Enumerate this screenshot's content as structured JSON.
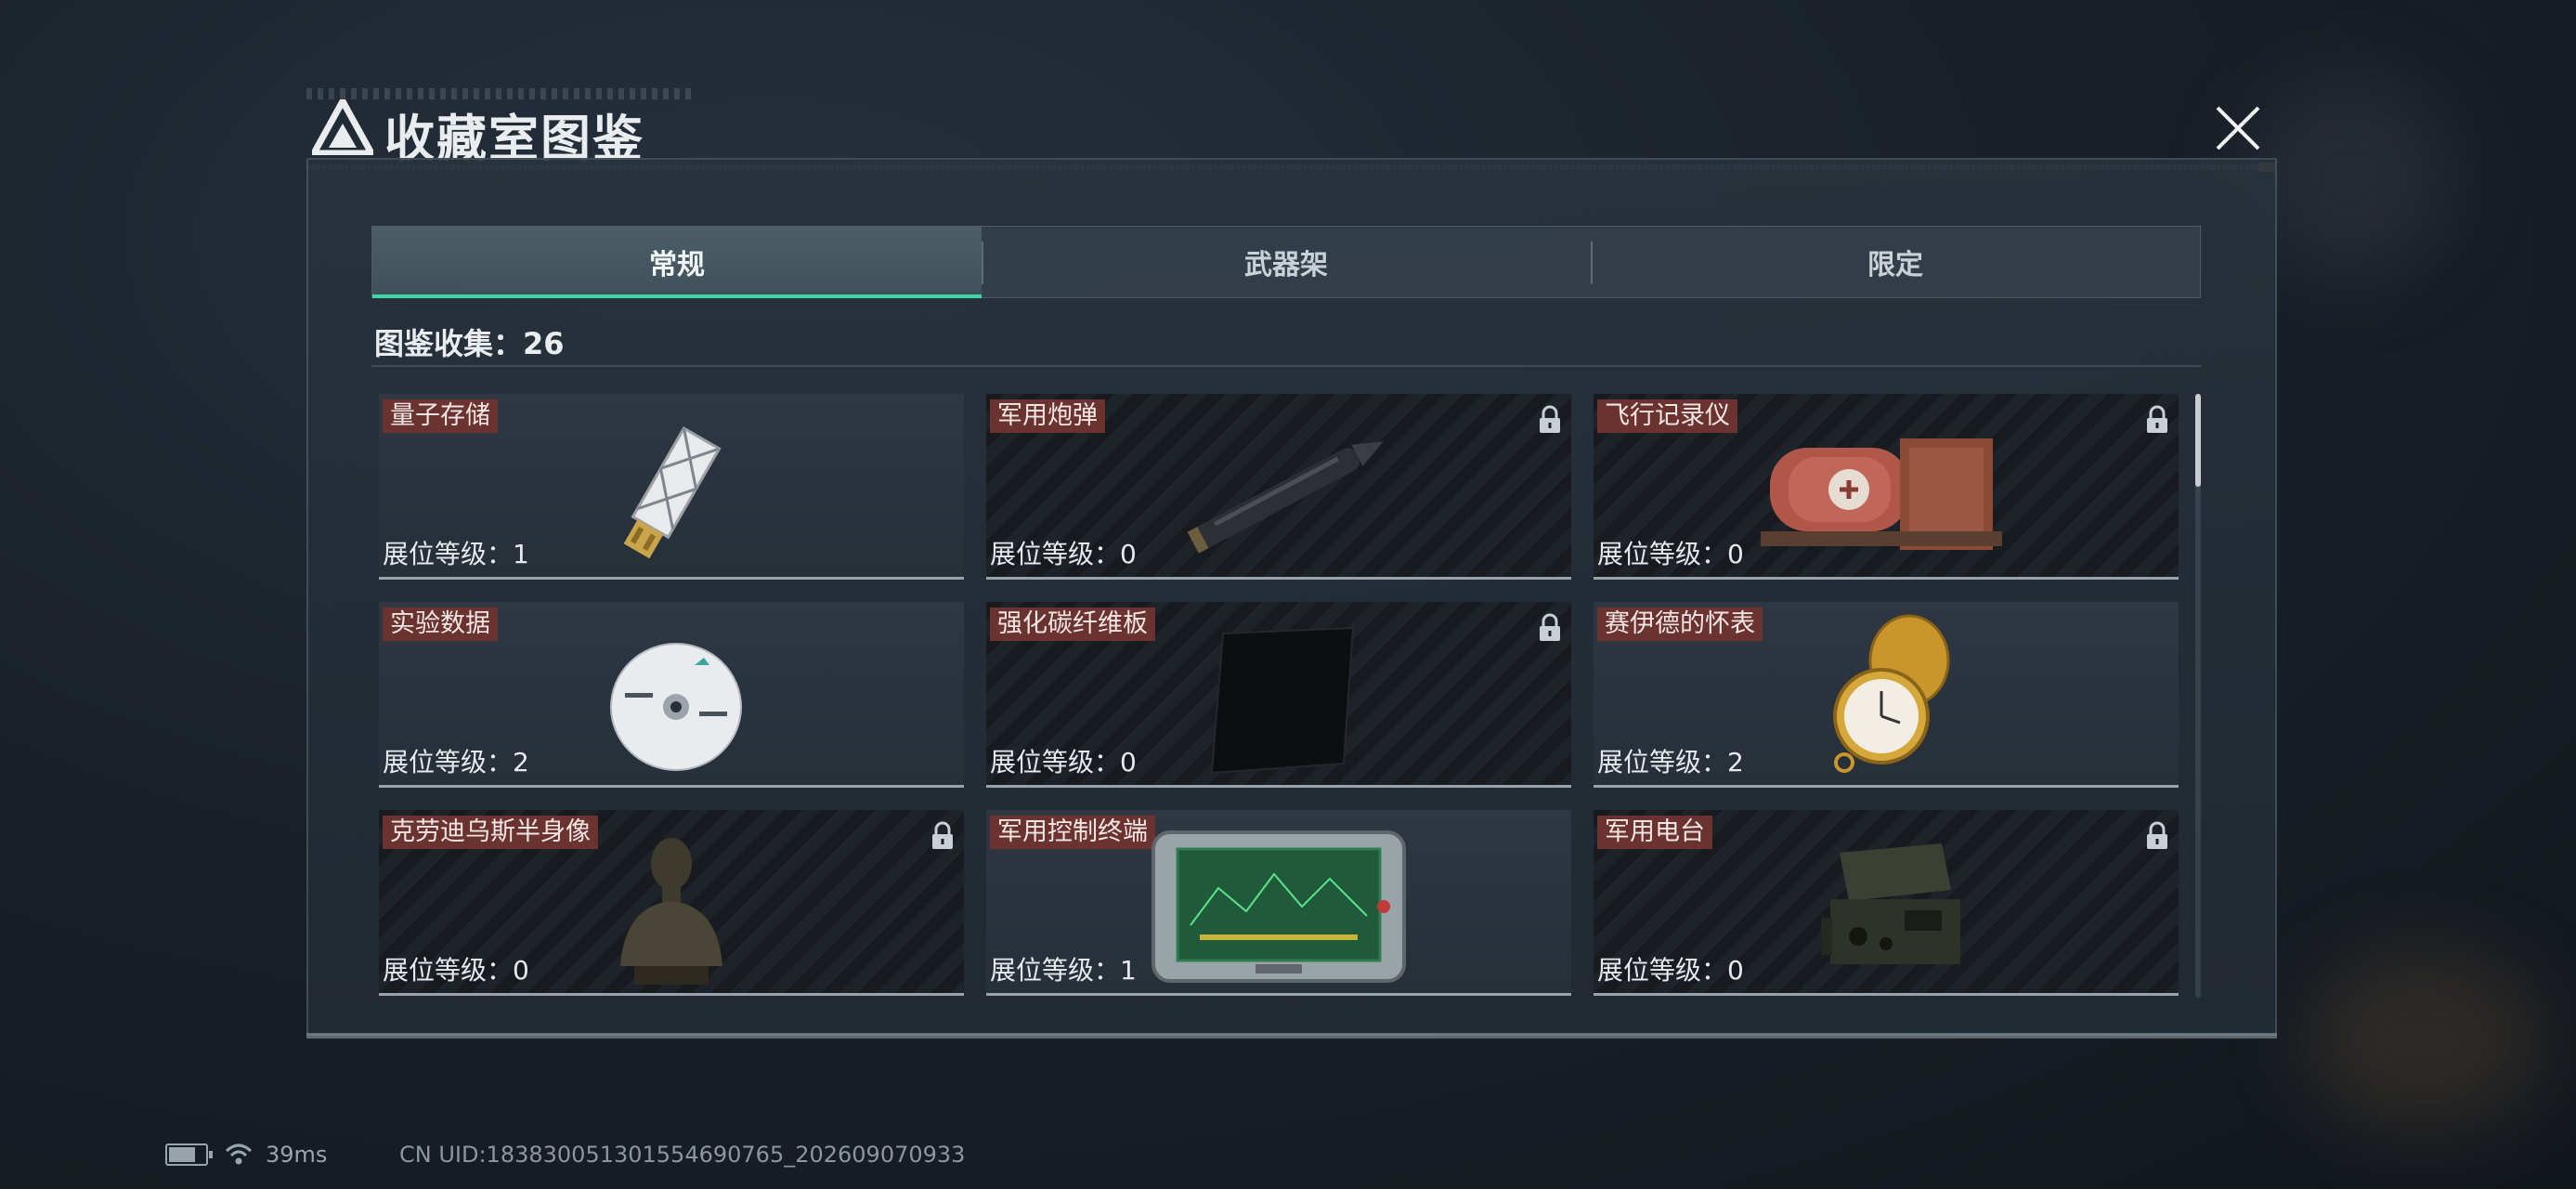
{
  "header": {
    "title": "收藏室图鉴",
    "close_label": "close"
  },
  "tabs": [
    {
      "label": "常规",
      "active": true
    },
    {
      "label": "武器架",
      "active": false
    },
    {
      "label": "限定",
      "active": false
    }
  ],
  "collection": {
    "label": "图鉴收集：",
    "count": "26"
  },
  "items": [
    {
      "name": "量子存储",
      "level_label": "展位等级：",
      "level": "1",
      "locked": false,
      "icon": "usb-drive-icon"
    },
    {
      "name": "军用炮弹",
      "level_label": "展位等级：",
      "level": "0",
      "locked": true,
      "icon": "artillery-shell-icon"
    },
    {
      "name": "飞行记录仪",
      "level_label": "展位等级：",
      "level": "0",
      "locked": true,
      "icon": "flight-recorder-icon"
    },
    {
      "name": "实验数据",
      "level_label": "展位等级：",
      "level": "2",
      "locked": false,
      "icon": "data-disc-icon"
    },
    {
      "name": "强化碳纤维板",
      "level_label": "展位等级：",
      "level": "0",
      "locked": true,
      "icon": "carbon-plate-icon"
    },
    {
      "name": "赛伊德的怀表",
      "level_label": "展位等级：",
      "level": "2",
      "locked": false,
      "icon": "pocket-watch-icon"
    },
    {
      "name": "克劳迪乌斯半身像",
      "level_label": "展位等级：",
      "level": "0",
      "locked": true,
      "icon": "bust-statue-icon"
    },
    {
      "name": "军用控制终端",
      "level_label": "展位等级：",
      "level": "1",
      "locked": false,
      "icon": "control-terminal-icon"
    },
    {
      "name": "军用电台",
      "level_label": "展位等级：",
      "level": "0",
      "locked": true,
      "icon": "military-radio-icon"
    }
  ],
  "status_bar": {
    "ping": "39ms",
    "uid": "CN UID:18383005130155469076​5_202609070933"
  },
  "colors": {
    "accent": "#3ed7a7",
    "name_tag": "#6a3330",
    "title_accent": "#c8803a"
  }
}
